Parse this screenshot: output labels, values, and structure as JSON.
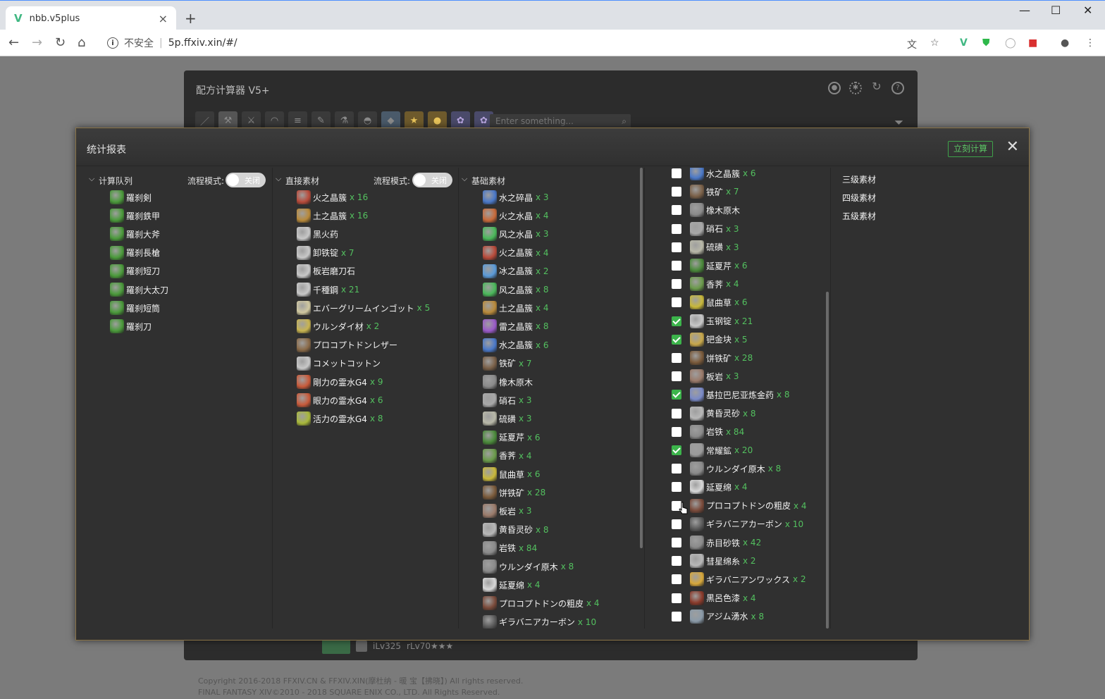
{
  "browser": {
    "tab_title": "nbb.v5plus",
    "tab_close": "×",
    "new_tab": "+",
    "insecure_label": "不安全",
    "url": "5p.ffxiv.xin/#/",
    "minimize": "—",
    "maximize": "☐",
    "close": "✕"
  },
  "app": {
    "title": "配方计算器 V5+",
    "search_placeholder": "Enter something...",
    "item_level": "iLv325",
    "recipe_level": "rLv70★★★",
    "copyright_1": "Copyright 2016-2018 FFXIV.CN & FFXIV.XIN(摩杜纳 - 暖 宝【拂晓】) All rights reserved.",
    "copyright_2": "FINAL FANTASY XIV©2010 - 2018 SQUARE ENIX CO., LTD. All Rights Reserved."
  },
  "modal": {
    "title": "统计报表",
    "calc_button": "立刻计算",
    "queue": {
      "header": "计算队列",
      "flow_label": "流程模式:",
      "flow_state": "关闭",
      "items": [
        "羅刹剣",
        "羅刹鉄甲",
        "羅刹大斧",
        "羅刹長槍",
        "羅刹短刀",
        "羅刹大太刀",
        "羅刹短筒",
        "羅刹刀"
      ]
    },
    "direct": {
      "header": "直接素材",
      "flow_label": "流程模式:",
      "flow_state": "关闭",
      "items": [
        {
          "name": "火之晶簇",
          "qty": "x 16",
          "color": "#b84a3a"
        },
        {
          "name": "土之晶簇",
          "qty": "x 16",
          "color": "#b8893a"
        },
        {
          "name": "黑火药",
          "qty": "",
          "color": "#c8c8c8"
        },
        {
          "name": "卸铁锭",
          "qty": "x 7",
          "color": "#c8c8c8"
        },
        {
          "name": "板岩磨刀石",
          "qty": "",
          "color": "#c8c8c8"
        },
        {
          "name": "千種鋼",
          "qty": "x 21",
          "color": "#c8c8c8"
        },
        {
          "name": "エバーグリームインゴット",
          "qty": "x 5",
          "color": "#d0c8a0"
        },
        {
          "name": "ウルンダイ材",
          "qty": "x 2",
          "color": "#c8b450"
        },
        {
          "name": "プロコプトドンレザー",
          "qty": "",
          "color": "#8a6a48"
        },
        {
          "name": "コメットコットン",
          "qty": "",
          "color": "#c8c8c8"
        },
        {
          "name": "剛力の霊水G4",
          "qty": "x 9",
          "color": "#c85a3a"
        },
        {
          "name": "眼力の霊水G4",
          "qty": "x 6",
          "color": "#c85a3a"
        },
        {
          "name": "活力の霊水G4",
          "qty": "x 8",
          "color": "#a8b83a"
        }
      ]
    },
    "base": {
      "header": "基础素材",
      "items": [
        {
          "name": "水之碎晶",
          "qty": "x 3",
          "color": "#4a78c8"
        },
        {
          "name": "火之水晶",
          "qty": "x 4",
          "color": "#c86a3a"
        },
        {
          "name": "风之水晶",
          "qty": "x 3",
          "color": "#4ab85a"
        },
        {
          "name": "火之晶簇",
          "qty": "x 4",
          "color": "#b84a3a"
        },
        {
          "name": "冰之晶簇",
          "qty": "x 2",
          "color": "#5a9ad8"
        },
        {
          "name": "风之晶簇",
          "qty": "x 8",
          "color": "#4ab85a"
        },
        {
          "name": "土之晶簇",
          "qty": "x 4",
          "color": "#b8893a"
        },
        {
          "name": "雷之晶簇",
          "qty": "x 8",
          "color": "#9a5ac8"
        },
        {
          "name": "水之晶簇",
          "qty": "x 6",
          "color": "#4a78c8"
        },
        {
          "name": "铁矿",
          "qty": "x 7",
          "color": "#7a6048"
        },
        {
          "name": "橡木原木",
          "qty": "",
          "color": "#8a8a8a"
        },
        {
          "name": "硝石",
          "qty": "x 3",
          "color": "#a8a8a8"
        },
        {
          "name": "硫磺",
          "qty": "x 3",
          "color": "#b8b8a8"
        },
        {
          "name": "延夏芹",
          "qty": "x 6",
          "color": "#4a8a3a"
        },
        {
          "name": "香荠",
          "qty": "x 4",
          "color": "#6a9a4a"
        },
        {
          "name": "鼠曲草",
          "qty": "x 6",
          "color": "#c8b83a"
        },
        {
          "name": "饼铁矿",
          "qty": "x 28",
          "color": "#7a5a3a"
        },
        {
          "name": "板岩",
          "qty": "x 3",
          "color": "#9a7a6a"
        },
        {
          "name": "黄昏灵砂",
          "qty": "x 8",
          "color": "#b8b8b8"
        },
        {
          "name": "岩铁",
          "qty": "x 84",
          "color": "#8a8a8a"
        },
        {
          "name": "ウルンダイ原木",
          "qty": "x 8",
          "color": "#8a8a8a"
        },
        {
          "name": "延夏绵",
          "qty": "x 4",
          "color": "#d8d8d8"
        },
        {
          "name": "プロコプトドンの粗皮",
          "qty": "x 4",
          "color": "#7a4a3a"
        },
        {
          "name": "ギラバニアカーボン",
          "qty": "x 10",
          "color": "#5a5a5a"
        }
      ]
    },
    "checklist": {
      "items": [
        {
          "name": "水之晶簇",
          "qty": "x 6",
          "checked": false,
          "color": "#4a78c8"
        },
        {
          "name": "铁矿",
          "qty": "x 7",
          "checked": false,
          "color": "#7a6048"
        },
        {
          "name": "橡木原木",
          "qty": "",
          "checked": false,
          "color": "#8a8a8a"
        },
        {
          "name": "硝石",
          "qty": "x 3",
          "checked": false,
          "color": "#a8a8a8"
        },
        {
          "name": "硫磺",
          "qty": "x 3",
          "checked": false,
          "color": "#b8b8a8"
        },
        {
          "name": "延夏芹",
          "qty": "x 6",
          "checked": false,
          "color": "#4a8a3a"
        },
        {
          "name": "香荠",
          "qty": "x 4",
          "checked": false,
          "color": "#6a9a4a"
        },
        {
          "name": "鼠曲草",
          "qty": "x 6",
          "checked": false,
          "color": "#c8b83a"
        },
        {
          "name": "玉钢锭",
          "qty": "x 21",
          "checked": true,
          "color": "#c8c8c8"
        },
        {
          "name": "钯金块",
          "qty": "x 5",
          "checked": true,
          "color": "#c8a84a"
        },
        {
          "name": "饼铁矿",
          "qty": "x 28",
          "checked": false,
          "color": "#7a5a3a"
        },
        {
          "name": "板岩",
          "qty": "x 3",
          "checked": false,
          "color": "#9a7a6a"
        },
        {
          "name": "基拉巴尼亚炼金药",
          "qty": "x 8",
          "checked": true,
          "color": "#7a8ac8"
        },
        {
          "name": "黄昏灵砂",
          "qty": "x 8",
          "checked": false,
          "color": "#b8b8b8"
        },
        {
          "name": "岩铁",
          "qty": "x 84",
          "checked": false,
          "color": "#8a8a8a"
        },
        {
          "name": "常耀鉱",
          "qty": "x 20",
          "checked": true,
          "color": "#9a9a9a"
        },
        {
          "name": "ウルンダイ原木",
          "qty": "x 8",
          "checked": false,
          "color": "#8a8a8a"
        },
        {
          "name": "延夏绵",
          "qty": "x 4",
          "checked": false,
          "color": "#d8d8d8"
        },
        {
          "name": "プロコプトドンの粗皮",
          "qty": "x 4",
          "checked": false,
          "color": "#7a4a3a"
        },
        {
          "name": "ギラバニアカーボン",
          "qty": "x 10",
          "checked": false,
          "color": "#5a5a5a"
        },
        {
          "name": "赤目砂铁",
          "qty": "x 42",
          "checked": false,
          "color": "#8a8a8a"
        },
        {
          "name": "彗星绵糸",
          "qty": "x 2",
          "checked": false,
          "color": "#b8b8b8"
        },
        {
          "name": "ギラバニアンワックス",
          "qty": "x 2",
          "checked": false,
          "color": "#d8a83a"
        },
        {
          "name": "黒呂色漆",
          "qty": "x 4",
          "checked": false,
          "color": "#8a3a2a"
        },
        {
          "name": "アジム湧水",
          "qty": "x 8",
          "checked": false,
          "color": "#8a9aa8"
        }
      ]
    },
    "tiers": [
      "三级素材",
      "四级素材",
      "五级素材"
    ]
  }
}
